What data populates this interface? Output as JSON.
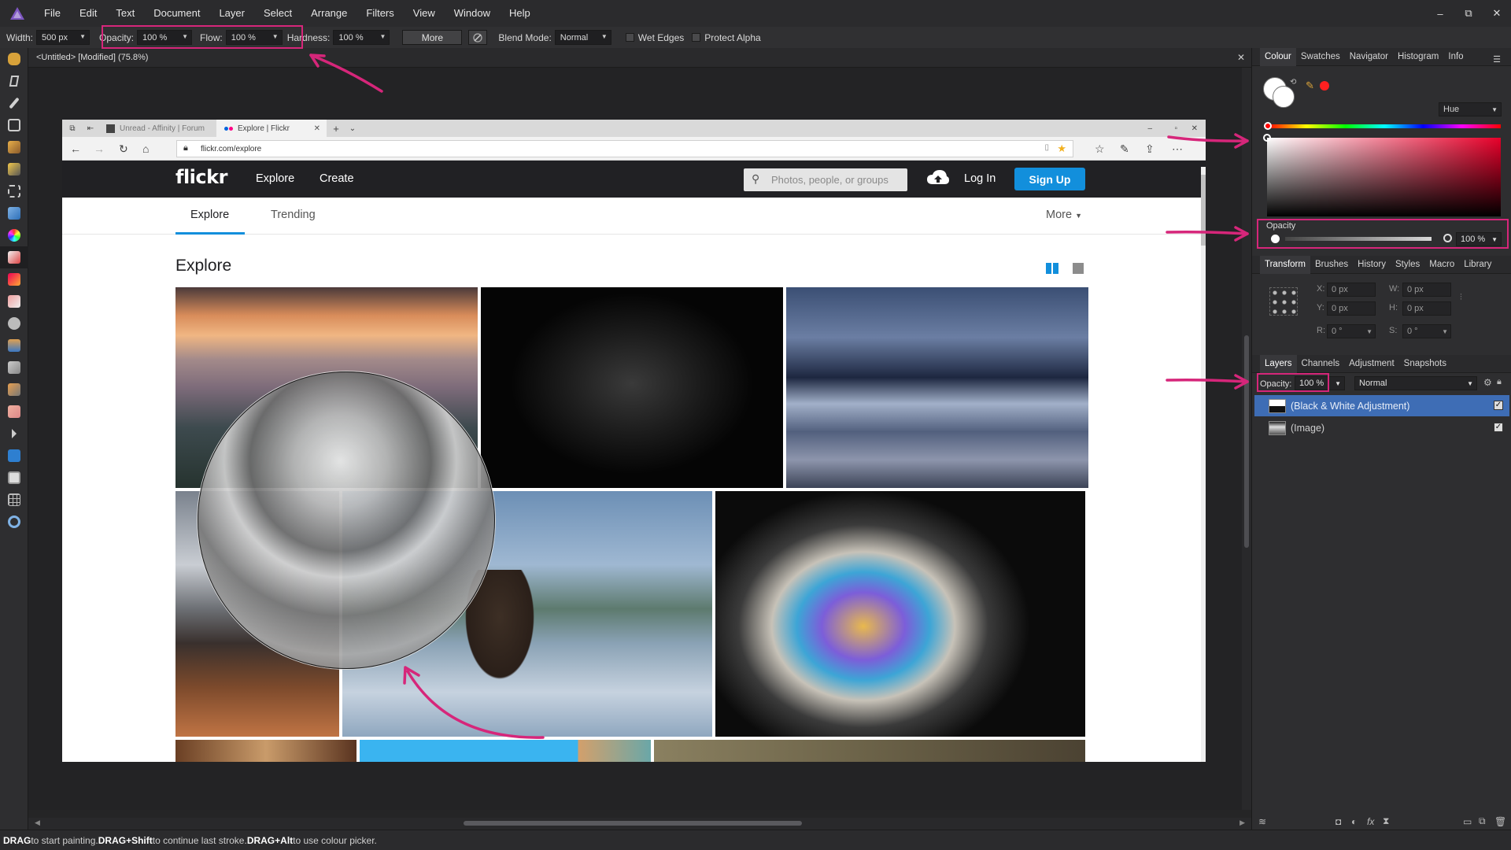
{
  "menubar": {
    "items": [
      "File",
      "Edit",
      "Text",
      "Document",
      "Layer",
      "Select",
      "Arrange",
      "Filters",
      "View",
      "Window",
      "Help"
    ],
    "window_controls": [
      "–",
      "⧉",
      "✕"
    ]
  },
  "context_toolbar": {
    "width_label": "Width:",
    "width_value": "500 px",
    "opacity_label": "Opacity:",
    "opacity_value": "100 %",
    "flow_label": "Flow:",
    "flow_value": "100 %",
    "hardness_label": "Hardness:",
    "hardness_value": "100 %",
    "more_label": "More",
    "blend_mode_label": "Blend Mode:",
    "blend_mode_value": "Normal",
    "wet_edges_label": "Wet Edges",
    "protect_alpha_label": "Protect Alpha"
  },
  "document": {
    "tab_title": "<Untitled> [Modified] (75.8%)",
    "close": "✕"
  },
  "status_bar": {
    "k1": "DRAG",
    "t1": " to start painting. ",
    "k2": "DRAG+Shift",
    "t2": " to continue last stroke. ",
    "k3": "DRAG+Alt",
    "t3": " to use colour picker."
  },
  "colour_panel": {
    "tabs": [
      "Colour",
      "Swatches",
      "Navigator",
      "Histogram",
      "Info"
    ],
    "model": "Hue",
    "opacity_label": "Opacity",
    "opacity_value": "100 %",
    "primary_color": "#ffffff",
    "accent_color": "#ff2020"
  },
  "transform_panel": {
    "tabs": [
      "Transform",
      "Brushes",
      "History",
      "Styles",
      "Macro",
      "Library"
    ],
    "x_label": "X:",
    "x_value": "0 px",
    "y_label": "Y:",
    "y_value": "0 px",
    "w_label": "W:",
    "w_value": "0 px",
    "h_label": "H:",
    "h_value": "0 px",
    "r_label": "R:",
    "r_value": "0 °",
    "s_label": "S:",
    "s_value": "0 °"
  },
  "layers_panel": {
    "tabs": [
      "Layers",
      "Channels",
      "Adjustment",
      "Snapshots"
    ],
    "opacity_label": "Opacity:",
    "opacity_value": "100 %",
    "blend_value": "Normal",
    "layers": [
      {
        "name": "(Black & White Adjustment)",
        "selected": true,
        "visible": true
      },
      {
        "name": "(Image)",
        "selected": false,
        "visible": true
      }
    ]
  },
  "browser": {
    "tabs": [
      {
        "title": "Unread - Affinity | Forum"
      },
      {
        "title": "Explore | Flickr",
        "close": "✕"
      }
    ],
    "url": "flickr.com/explore"
  },
  "flickr": {
    "logo": "flickr",
    "nav": [
      "Explore",
      "Create"
    ],
    "search_placeholder": "Photos, people, or groups",
    "login": "Log In",
    "signup": "Sign Up",
    "subnav": [
      "Explore",
      "Trending"
    ],
    "more": "More",
    "page_title": "Explore"
  },
  "annotation_color": "#d6267a"
}
